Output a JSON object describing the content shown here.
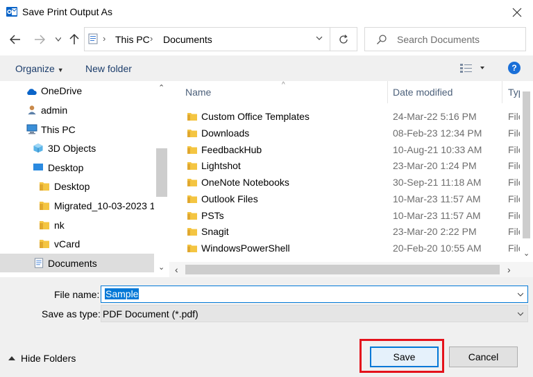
{
  "window": {
    "title": "Save Print Output As",
    "app_icon": "outlook-icon",
    "close_icon": "close-icon"
  },
  "nav": {
    "back_icon": "arrow-left-icon",
    "forward_icon": "arrow-right-icon",
    "recent_icon": "chevron-down-icon",
    "up_icon": "arrow-up-icon",
    "breadcrumb": [
      "This PC",
      "Documents"
    ],
    "refresh_icon": "refresh-icon",
    "search_placeholder": "Search Documents"
  },
  "toolbar": {
    "organize": "Organize",
    "new_folder": "New folder",
    "view_icon": "view-options-icon",
    "help": "?"
  },
  "tree": [
    {
      "label": "OneDrive",
      "icon": "cloud-icon",
      "indent": 1
    },
    {
      "label": "admin",
      "icon": "user-icon",
      "indent": 1
    },
    {
      "label": "This PC",
      "icon": "computer-icon",
      "indent": 1
    },
    {
      "label": "3D Objects",
      "icon": "cube-icon",
      "indent": 2
    },
    {
      "label": "Desktop",
      "icon": "desktop-icon",
      "indent": 2
    },
    {
      "label": "Desktop",
      "icon": "folder-icon",
      "indent": 3
    },
    {
      "label": "Migrated_10-03-2023 1",
      "icon": "folder-icon",
      "indent": 3
    },
    {
      "label": "nk",
      "icon": "folder-icon",
      "indent": 3
    },
    {
      "label": "vCard",
      "icon": "folder-icon",
      "indent": 3
    },
    {
      "label": "Documents",
      "icon": "documents-icon",
      "indent": 2,
      "selected": true
    }
  ],
  "columns": {
    "name": "Name",
    "date": "Date modified",
    "type": "Typ"
  },
  "files": [
    {
      "name": "Custom Office Templates",
      "date": "24-Mar-22 5:16 PM",
      "type": "File"
    },
    {
      "name": "Downloads",
      "date": "08-Feb-23 12:34 PM",
      "type": "File"
    },
    {
      "name": "FeedbackHub",
      "date": "10-Aug-21 10:33 AM",
      "type": "File"
    },
    {
      "name": "Lightshot",
      "date": "23-Mar-20 1:24 PM",
      "type": "File"
    },
    {
      "name": "OneNote Notebooks",
      "date": "30-Sep-21 11:18 AM",
      "type": "File"
    },
    {
      "name": "Outlook Files",
      "date": "10-Mar-23 11:57 AM",
      "type": "File"
    },
    {
      "name": "PSTs",
      "date": "10-Mar-23 11:57 AM",
      "type": "File"
    },
    {
      "name": "Snagit",
      "date": "23-Mar-20 2:22 PM",
      "type": "File"
    },
    {
      "name": "WindowsPowerShell",
      "date": "20-Feb-20 10:55 AM",
      "type": "File"
    }
  ],
  "form": {
    "file_name_label": "File name:",
    "file_name_value": "Sample",
    "save_as_type_label": "Save as type:",
    "save_as_type_value": "PDF Document (*.pdf)"
  },
  "footer": {
    "hide_folders": "Hide Folders",
    "save": "Save",
    "cancel": "Cancel"
  },
  "colors": {
    "accent": "#0078d7",
    "highlight": "#e4121b",
    "folder": "#f4c542"
  }
}
